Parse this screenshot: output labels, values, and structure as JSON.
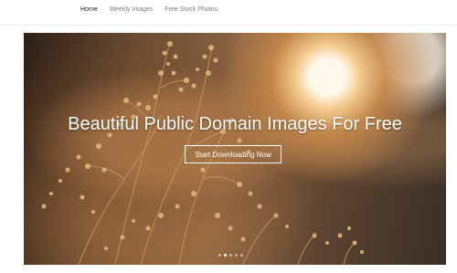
{
  "nav": {
    "items": [
      {
        "label": "Home",
        "active": true
      },
      {
        "label": "Weekly Images",
        "active": false
      },
      {
        "label": "Free Stock Photos",
        "active": false
      }
    ]
  },
  "hero": {
    "title": "Beautiful Public Domain Images For Free",
    "cta_label": "Start Downloading Now",
    "slides": {
      "count": 5,
      "active_index": 1
    }
  },
  "colors": {
    "text_light": "#ffffff",
    "nav_active": "#222222",
    "nav_inactive": "#7a7a7a"
  }
}
